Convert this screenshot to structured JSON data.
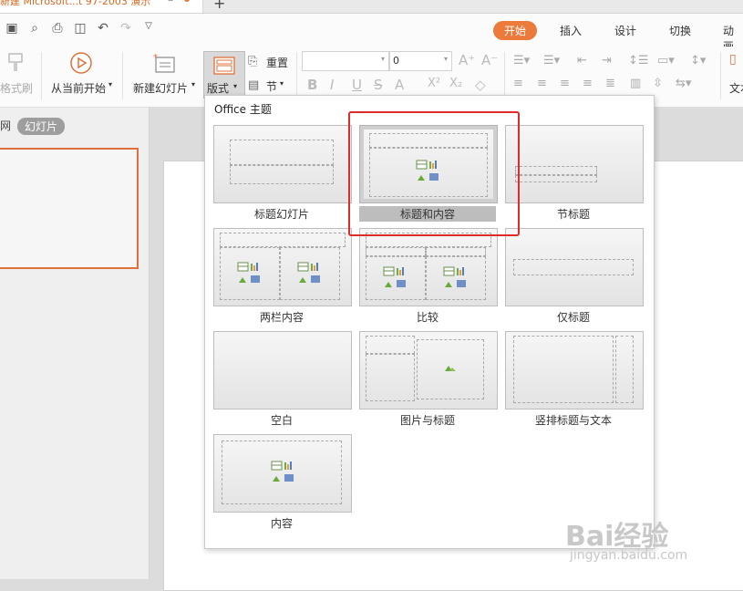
{
  "window": {
    "doc_title": "新建 Microsoft...t 97-2003 演示"
  },
  "quick_access": [
    "save-icon",
    "search-icon",
    "print-icon",
    "preview-icon",
    "undo-icon",
    "redo-icon",
    "more-icon"
  ],
  "menu_tabs": [
    "开始",
    "插入",
    "设计",
    "切换",
    "动画"
  ],
  "ribbon": {
    "format_painter": "格式刷",
    "from_current": "从当前开始",
    "new_slide": "新建幻灯片",
    "layout": "版式",
    "reset": "重置",
    "section": "节",
    "font_size": "0",
    "text_label": "文本"
  },
  "left_pane": {
    "tab_outline": "网",
    "tab_slides": "幻灯片"
  },
  "layout_menu": {
    "title": "Office 主题",
    "items": [
      {
        "label": "标题幻灯片"
      },
      {
        "label": "标题和内容",
        "selected": true
      },
      {
        "label": "节标题"
      },
      {
        "label": "两栏内容"
      },
      {
        "label": "比较"
      },
      {
        "label": "仅标题"
      },
      {
        "label": "空白"
      },
      {
        "label": "图片与标题"
      },
      {
        "label": "竖排标题与文本"
      },
      {
        "label": "内容"
      }
    ]
  },
  "watermark": {
    "text": "Bai经验",
    "url": "jingyan.baidu.com"
  },
  "colors": {
    "accent": "#ec7a3b",
    "highlight": "#e02b2b"
  }
}
